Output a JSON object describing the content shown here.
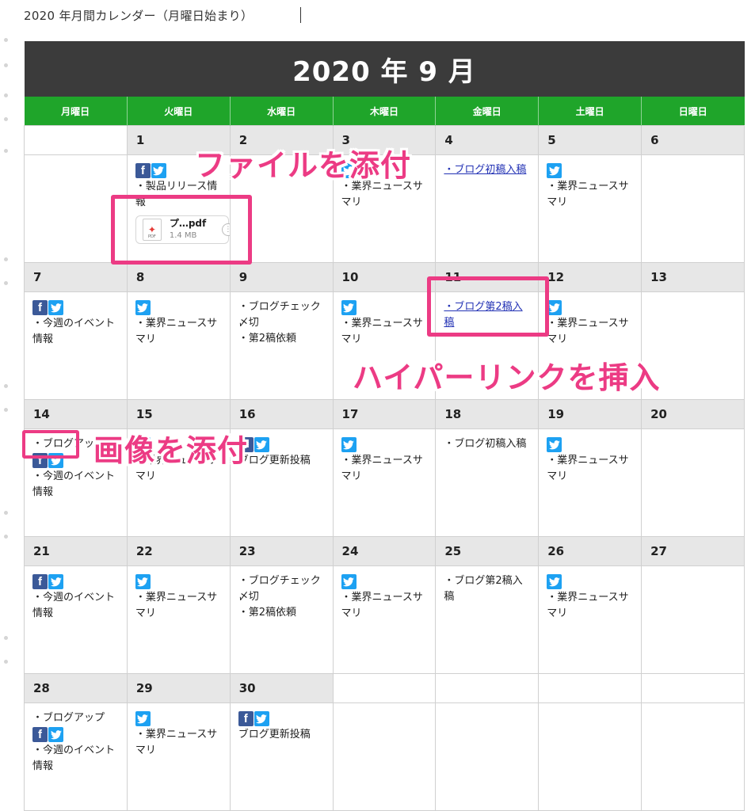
{
  "document": {
    "title": "2020 年月間カレンダー（月曜日始まり）"
  },
  "calendar": {
    "month_label": "2020 年 9 月",
    "weekdays": [
      "月曜日",
      "火曜日",
      "水曜日",
      "木曜日",
      "金曜日",
      "土曜日",
      "日曜日"
    ],
    "colors": {
      "header_bg": "#3b3b3b",
      "weekday_bg": "#1fa52a",
      "day_number_bg": "#e7e7e7",
      "highlight": "#ec3b84",
      "facebook": "#3b5998",
      "twitter": "#1da1f2"
    },
    "weeks": [
      [
        {
          "day": "",
          "items": []
        },
        {
          "day": "1",
          "items": [
            {
              "type": "social",
              "fb": true,
              "tw": true
            },
            {
              "type": "text",
              "text": "・製品リリース情報"
            },
            {
              "type": "file",
              "name": "プ…pdf",
              "size": "1.4 MB",
              "icon": "pdf-icon",
              "badge": "PDF"
            }
          ]
        },
        {
          "day": "2",
          "items": []
        },
        {
          "day": "3",
          "items": [
            {
              "type": "social",
              "fb": false,
              "tw": true
            },
            {
              "type": "text",
              "text": "・業界ニュースサマリ"
            }
          ]
        },
        {
          "day": "4",
          "items": [
            {
              "type": "link",
              "text": "・ブログ初稿入稿"
            }
          ]
        },
        {
          "day": "5",
          "items": [
            {
              "type": "social",
              "fb": false,
              "tw": true
            },
            {
              "type": "text",
              "text": "・業界ニュースサマリ"
            }
          ]
        },
        {
          "day": "6",
          "items": []
        }
      ],
      [
        {
          "day": "7",
          "items": [
            {
              "type": "social",
              "fb": true,
              "tw": true
            },
            {
              "type": "text",
              "text": "・今週のイベント情報"
            }
          ]
        },
        {
          "day": "8",
          "items": [
            {
              "type": "social",
              "fb": false,
              "tw": true
            },
            {
              "type": "text",
              "text": "・業界ニュースサマリ"
            }
          ]
        },
        {
          "day": "9",
          "items": [
            {
              "type": "text",
              "text": "・ブログチェック〆切"
            },
            {
              "type": "text",
              "text": "・第2稿依頼"
            }
          ]
        },
        {
          "day": "10",
          "items": [
            {
              "type": "social",
              "fb": false,
              "tw": true
            },
            {
              "type": "text",
              "text": "・業界ニュースサマリ"
            }
          ]
        },
        {
          "day": "11",
          "items": [
            {
              "type": "link",
              "text": "・ブログ第2稿入稿"
            }
          ]
        },
        {
          "day": "12",
          "items": [
            {
              "type": "social",
              "fb": false,
              "tw": true
            },
            {
              "type": "text",
              "text": "・業界ニュースサマリ"
            }
          ]
        },
        {
          "day": "13",
          "items": []
        }
      ],
      [
        {
          "day": "14",
          "items": [
            {
              "type": "text",
              "text": "・ブログアップ"
            },
            {
              "type": "social",
              "fb": true,
              "tw": true
            },
            {
              "type": "text",
              "text": "・今週のイベント情報"
            }
          ]
        },
        {
          "day": "15",
          "items": [
            {
              "type": "social",
              "fb": false,
              "tw": true
            },
            {
              "type": "text",
              "text": "・業界ニュースサマリ"
            }
          ]
        },
        {
          "day": "16",
          "items": [
            {
              "type": "social",
              "fb": true,
              "tw": true
            },
            {
              "type": "text",
              "text": "ブログ更新投稿"
            }
          ]
        },
        {
          "day": "17",
          "items": [
            {
              "type": "social",
              "fb": false,
              "tw": true
            },
            {
              "type": "text",
              "text": "・業界ニュースサマリ"
            }
          ]
        },
        {
          "day": "18",
          "items": [
            {
              "type": "text",
              "text": "・ブログ初稿入稿"
            }
          ]
        },
        {
          "day": "19",
          "items": [
            {
              "type": "social",
              "fb": false,
              "tw": true
            },
            {
              "type": "text",
              "text": "・業界ニュースサマリ"
            }
          ]
        },
        {
          "day": "20",
          "items": []
        }
      ],
      [
        {
          "day": "21",
          "items": [
            {
              "type": "social",
              "fb": true,
              "tw": true
            },
            {
              "type": "text",
              "text": "・今週のイベント情報"
            }
          ]
        },
        {
          "day": "22",
          "items": [
            {
              "type": "social",
              "fb": false,
              "tw": true
            },
            {
              "type": "text",
              "text": "・業界ニュースサマリ"
            }
          ]
        },
        {
          "day": "23",
          "items": [
            {
              "type": "text",
              "text": "・ブログチェック〆切"
            },
            {
              "type": "text",
              "text": "・第2稿依頼"
            }
          ]
        },
        {
          "day": "24",
          "items": [
            {
              "type": "social",
              "fb": false,
              "tw": true
            },
            {
              "type": "text",
              "text": "・業界ニュースサマリ"
            }
          ]
        },
        {
          "day": "25",
          "items": [
            {
              "type": "text",
              "text": "・ブログ第2稿入稿"
            }
          ]
        },
        {
          "day": "26",
          "items": [
            {
              "type": "social",
              "fb": false,
              "tw": true
            },
            {
              "type": "text",
              "text": "・業界ニュースサマリ"
            }
          ]
        },
        {
          "day": "27",
          "items": []
        }
      ],
      [
        {
          "day": "28",
          "items": [
            {
              "type": "text",
              "text": "・ブログアップ"
            },
            {
              "type": "social",
              "fb": true,
              "tw": true
            },
            {
              "type": "text",
              "text": "・今週のイベント情報"
            }
          ]
        },
        {
          "day": "29",
          "items": [
            {
              "type": "social",
              "fb": false,
              "tw": true
            },
            {
              "type": "text",
              "text": "・業界ニュースサマリ"
            }
          ]
        },
        {
          "day": "30",
          "items": [
            {
              "type": "social",
              "fb": true,
              "tw": true
            },
            {
              "type": "text",
              "text": "ブログ更新投稿"
            }
          ]
        },
        {
          "day": "",
          "items": []
        },
        {
          "day": "",
          "items": []
        },
        {
          "day": "",
          "items": []
        },
        {
          "day": "",
          "items": []
        }
      ]
    ]
  },
  "annotations": {
    "attach_file": "ファイルを添付",
    "insert_hyperlink": "ハイパーリンクを挿入",
    "attach_image": "画像を添付"
  }
}
